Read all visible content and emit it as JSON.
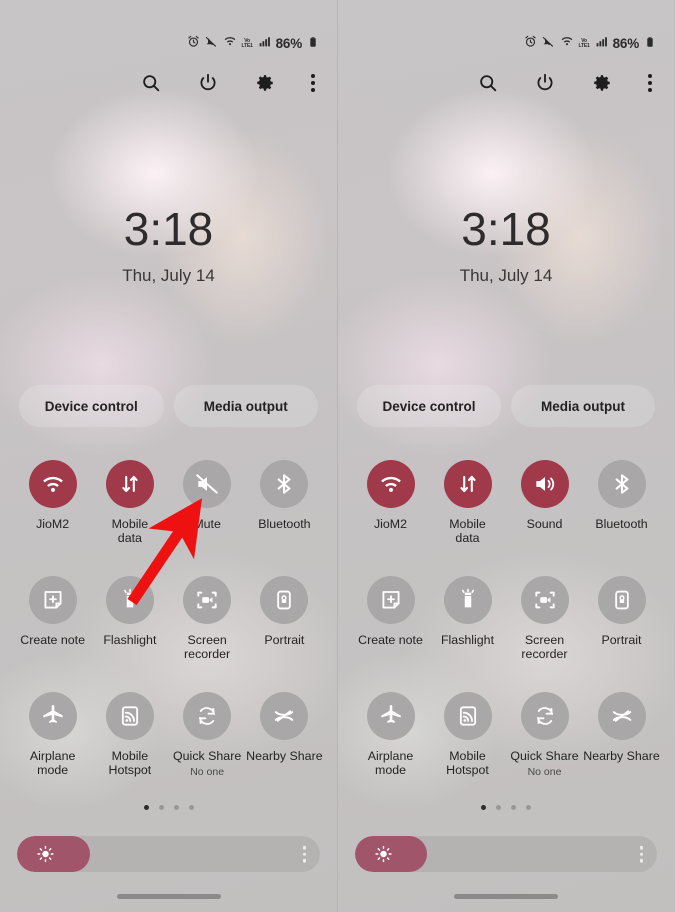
{
  "colors": {
    "active_toggle": "#a03a4a",
    "inactive_toggle": "#a9a7a7",
    "annotation_arrow": "#ee1111",
    "slider_fill": "#a0556a",
    "slider_track": "#b5b2b2"
  },
  "status_bar": {
    "alarm_icon": "alarm-icon",
    "mute_icon": "mute-bell-icon",
    "wifi_icon": "wifi-icon",
    "volte_label": "VoLTE1",
    "signal_icon": "signal-bars-icon",
    "battery_percent": "86%",
    "battery_icon": "battery-icon"
  },
  "header": {
    "search_icon": "search-icon",
    "power_icon": "power-icon",
    "settings_icon": "gear-icon",
    "more_icon": "kebab-menu-icon"
  },
  "clock": {
    "time": "3:18",
    "date": "Thu, July 14"
  },
  "pills": {
    "device_control": "Device control",
    "media_output": "Media output"
  },
  "panels": [
    {
      "id": "left-panel",
      "toggles": [
        {
          "label": "JioM2",
          "sub": "",
          "icon": "wifi-icon",
          "state": "on"
        },
        {
          "label": "Mobile\ndata",
          "sub": "",
          "icon": "mobile-data-icon",
          "state": "on"
        },
        {
          "label": "Mute",
          "sub": "",
          "icon": "volume-mute-icon",
          "state": "off"
        },
        {
          "label": "Bluetooth",
          "sub": "",
          "icon": "bluetooth-icon",
          "state": "off"
        },
        {
          "label": "Create note",
          "sub": "",
          "icon": "create-note-icon",
          "state": "off"
        },
        {
          "label": "Flashlight",
          "sub": "",
          "icon": "flashlight-icon",
          "state": "off"
        },
        {
          "label": "Screen\nrecorder",
          "sub": "",
          "icon": "screen-recorder-icon",
          "state": "off"
        },
        {
          "label": "Portrait",
          "sub": "",
          "icon": "rotation-lock-icon",
          "state": "off"
        },
        {
          "label": "Airplane\nmode",
          "sub": "",
          "icon": "airplane-icon",
          "state": "off"
        },
        {
          "label": "Mobile\nHotspot",
          "sub": "",
          "icon": "hotspot-icon",
          "state": "off"
        },
        {
          "label": "Quick Share",
          "sub": "No one",
          "icon": "quick-share-icon",
          "state": "off"
        },
        {
          "label": "Nearby Share",
          "sub": "",
          "icon": "nearby-share-icon",
          "state": "off"
        }
      ]
    },
    {
      "id": "right-panel",
      "toggles": [
        {
          "label": "JioM2",
          "sub": "",
          "icon": "wifi-icon",
          "state": "on"
        },
        {
          "label": "Mobile\ndata",
          "sub": "",
          "icon": "mobile-data-icon",
          "state": "on"
        },
        {
          "label": "Sound",
          "sub": "",
          "icon": "volume-on-icon",
          "state": "on"
        },
        {
          "label": "Bluetooth",
          "sub": "",
          "icon": "bluetooth-icon",
          "state": "off"
        },
        {
          "label": "Create note",
          "sub": "",
          "icon": "create-note-icon",
          "state": "off"
        },
        {
          "label": "Flashlight",
          "sub": "",
          "icon": "flashlight-icon",
          "state": "off"
        },
        {
          "label": "Screen\nrecorder",
          "sub": "",
          "icon": "screen-recorder-icon",
          "state": "off"
        },
        {
          "label": "Portrait",
          "sub": "",
          "icon": "rotation-lock-icon",
          "state": "off"
        },
        {
          "label": "Airplane\nmode",
          "sub": "",
          "icon": "airplane-icon",
          "state": "off"
        },
        {
          "label": "Mobile\nHotspot",
          "sub": "",
          "icon": "hotspot-icon",
          "state": "off"
        },
        {
          "label": "Quick Share",
          "sub": "No one",
          "icon": "quick-share-icon",
          "state": "off"
        },
        {
          "label": "Nearby Share",
          "sub": "",
          "icon": "nearby-share-icon",
          "state": "off"
        }
      ]
    }
  ],
  "page_dots": {
    "count": 4,
    "active_index": 0
  },
  "brightness": {
    "value_percent": 24,
    "sun_icon": "brightness-sun-icon",
    "more_icon": "kebab-menu-icon"
  },
  "nav_handle": "gesture-handle",
  "annotation": {
    "type": "arrow",
    "points_to": "Mute",
    "color": "#ee1111"
  }
}
